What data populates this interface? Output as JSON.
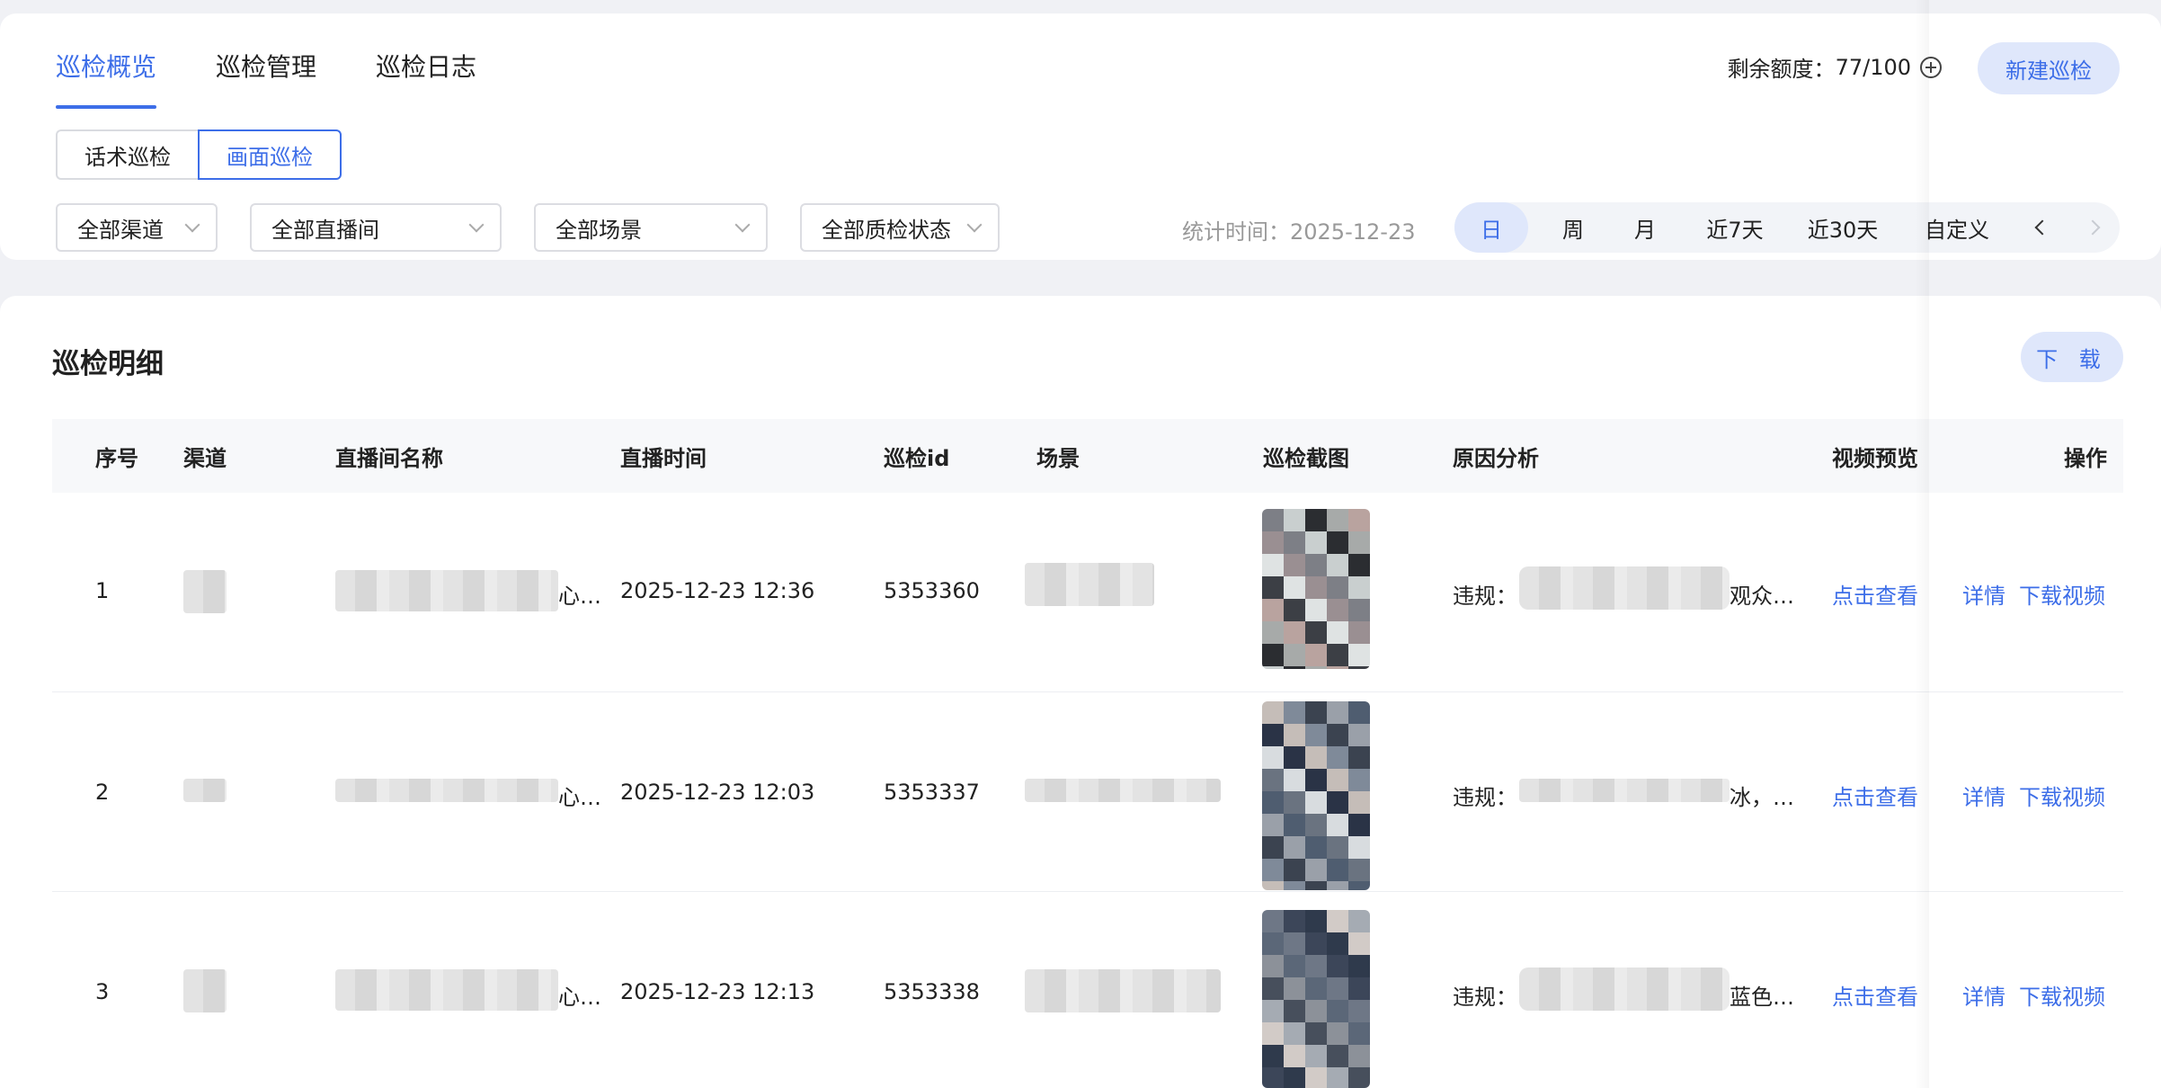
{
  "tabs": [
    "巡检概览",
    "巡检管理",
    "巡检日志"
  ],
  "quota": {
    "label": "剩余额度：",
    "value": "77/100"
  },
  "new_button": "新建巡检",
  "segments": [
    "话术巡检",
    "画面巡检"
  ],
  "filters": {
    "channel": "全部渠道",
    "room": "全部直播间",
    "scene": "全部场景",
    "status": "全部质检状态"
  },
  "stat_time": {
    "label": "统计时间：",
    "value": "2025-12-23"
  },
  "ranges": [
    "日",
    "周",
    "月",
    "近7天",
    "近30天",
    "自定义"
  ],
  "accent": "#3d6ee8",
  "detail": {
    "title": "巡检明细",
    "download_label": "下 载",
    "columns": [
      "序号",
      "渠道",
      "直播间名称",
      "直播时间",
      "巡检id",
      "场景",
      "巡检截图",
      "原因分析",
      "视频预览",
      "操作"
    ],
    "rows": [
      {
        "index": "1",
        "room_suffix": "心…",
        "time": "2025-12-23 12:36",
        "id": "5353360",
        "reason_prefix": "违规：",
        "reason_suffix": "观众…",
        "preview": "点击查看",
        "detail": "详情",
        "download": "下载视频"
      },
      {
        "index": "2",
        "room_suffix": "心…",
        "time": "2025-12-23 12:03",
        "id": "5353337",
        "reason_prefix": "违规：",
        "reason_suffix": "冰，…",
        "preview": "点击查看",
        "detail": "详情",
        "download": "下载视频"
      },
      {
        "index": "3",
        "room_suffix": "心…",
        "time": "2025-12-23 12:13",
        "id": "5353338",
        "reason_prefix": "违规：",
        "reason_suffix": "蓝色…",
        "preview": "点击查看",
        "detail": "详情",
        "download": "下载视频"
      }
    ]
  }
}
